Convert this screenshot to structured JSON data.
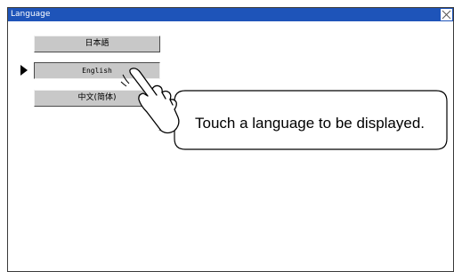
{
  "window": {
    "title": "Language",
    "close_icon": "close-x-icon"
  },
  "languages": [
    {
      "label": "日本語",
      "selected": false
    },
    {
      "label": "English",
      "selected": true
    },
    {
      "label": "中文(简体)",
      "selected": false
    }
  ],
  "selection_indicator_icon": "triangle-right-icon",
  "hint": {
    "icon": "pointing-hand-icon",
    "text": "Touch a language to be displayed."
  },
  "colors": {
    "titlebar": "#1e54b9",
    "button_face": "#c8c8c8",
    "background": "#ffffff"
  }
}
